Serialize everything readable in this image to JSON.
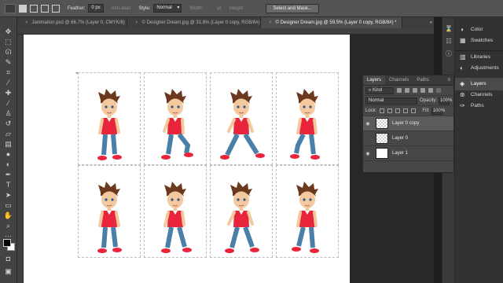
{
  "options_bar": {
    "feather_label": "Feather:",
    "feather_value": "0 px",
    "antialias_label": "Anti-alias",
    "style_label": "Style:",
    "style_value": "Normal",
    "width_label": "Width:",
    "height_label": "Height:",
    "select_mask_label": "Select and Mask..."
  },
  "tabs": [
    {
      "label": "Janimation.psd @ 66.7% (Layer 0, CMYK/8)",
      "active": false
    },
    {
      "label": "© Designer Dream.jpg @ 31.8% (Layer 0 copy, RGB/8#)",
      "active": false
    },
    {
      "label": "© Designer Dream.jpg @ 59.5% (Layer 0 copy, RGB/8#) *",
      "active": true
    }
  ],
  "tab_overflow": "»",
  "toolbar_icons": [
    "move-icon",
    "marquee-icon",
    "lasso-icon",
    "quick-select-icon",
    "crop-icon",
    "eyedropper-icon",
    "healing-icon",
    "brush-icon",
    "stamp-icon",
    "history-brush-icon",
    "eraser-icon",
    "gradient-icon",
    "blur-icon",
    "dodge-icon",
    "pen-icon",
    "type-icon",
    "path-select-icon",
    "shape-icon",
    "hand-icon",
    "zoom-icon",
    "more-icon"
  ],
  "right_panel": {
    "items": [
      {
        "label": "Color",
        "icon": "color-icon"
      },
      {
        "label": "Swatches",
        "icon": "swatches-icon"
      },
      {
        "label": "Libraries",
        "icon": "libraries-icon"
      },
      {
        "label": "Adjustments",
        "icon": "adjustments-icon"
      },
      {
        "label": "Layers",
        "icon": "layers-icon",
        "active": true
      },
      {
        "label": "Channels",
        "icon": "channels-icon"
      },
      {
        "label": "Paths",
        "icon": "paths-icon"
      }
    ]
  },
  "layers_panel": {
    "tabs": [
      "Layers",
      "Channels",
      "Paths"
    ],
    "kind": "Kind",
    "blend_mode": "Normal",
    "opacity_label": "Opacity:",
    "opacity_value": "100%",
    "lock_label": "Lock:",
    "fill_label": "Fill:",
    "fill_value": "100%",
    "layers": [
      {
        "name": "Layer 0 copy",
        "visible": true,
        "selected": true,
        "thumb": "transparent"
      },
      {
        "name": "Layer 0",
        "visible": false,
        "selected": false,
        "thumb": "transparent"
      },
      {
        "name": "Layer 1",
        "visible": true,
        "selected": false,
        "thumb": "white"
      }
    ]
  },
  "canvas": {
    "frames": 8,
    "shirt_color": "#e8253a",
    "jeans_color": "#4a7fa8",
    "hair_color": "#6b3a1e",
    "skin_color": "#f5c9a0"
  }
}
